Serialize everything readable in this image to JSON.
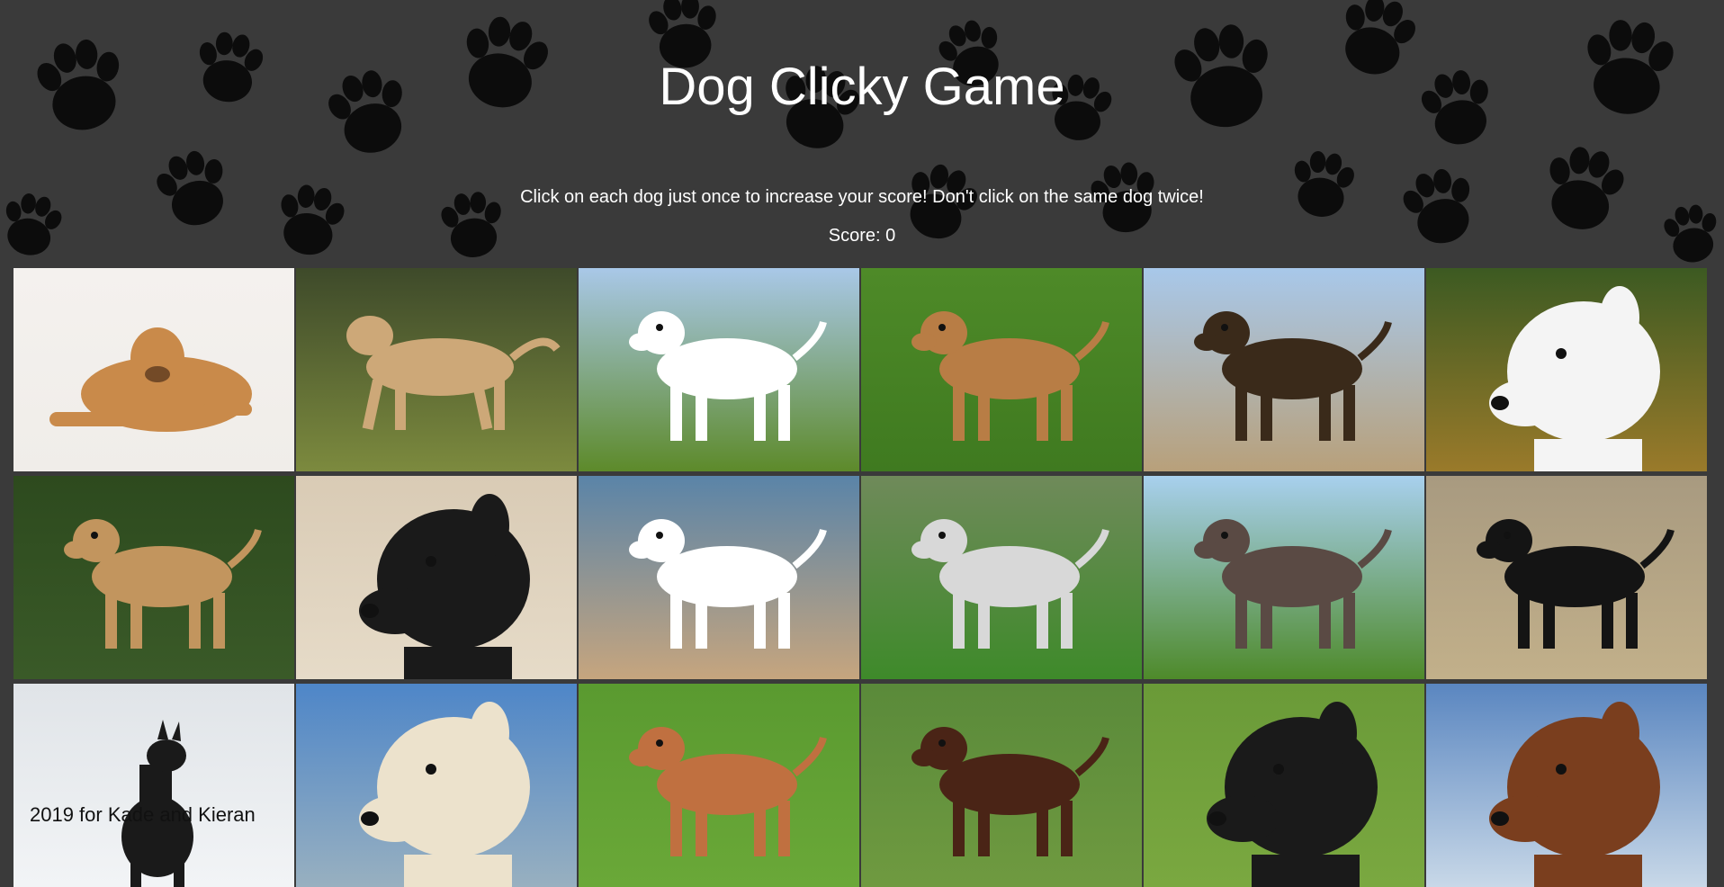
{
  "header": {
    "title": "Dog Clicky Game",
    "instructions": "Click on each dog just once to increase your score! Don't click on the same dog twice!",
    "score_label": "Score: 0"
  },
  "footer": {
    "text": "2019 for Kade and Kieran"
  },
  "colors": {
    "background": "#3a3a3a",
    "paw_print": "#0c0c0c",
    "text": "#ffffff"
  },
  "dogs": [
    {
      "breed": "golden-retriever",
      "bg_top": "#f4f1ee",
      "bg_bottom": "#f0ede9",
      "dog": "#c98a4a",
      "pose": "lying"
    },
    {
      "breed": "irish-wolfhound",
      "bg_top": "#3e4a2a",
      "bg_bottom": "#7c8a3e",
      "dog": "#cda878",
      "pose": "walking"
    },
    {
      "breed": "beagle",
      "bg_top": "#a9c8e8",
      "bg_bottom": "#5d8a2a",
      "dog": "#ffffff",
      "pose": "standing"
    },
    {
      "breed": "vizsla",
      "bg_top": "#4e8a28",
      "bg_bottom": "#3f7a20",
      "dog": "#b87d45",
      "pose": "standing"
    },
    {
      "breed": "german-shepherd",
      "bg_top": "#a8c8ea",
      "bg_bottom": "#b8a07a",
      "dog": "#3a2a1a",
      "pose": "standing"
    },
    {
      "breed": "bull-terrier",
      "bg_top": "#3c5a22",
      "bg_bottom": "#9a7a2a",
      "dog": "#f4f4f4",
      "pose": "head"
    },
    {
      "breed": "shar-pei",
      "bg_top": "#2d4a1e",
      "bg_bottom": "#3a5a28",
      "dog": "#c2955e",
      "pose": "standing"
    },
    {
      "breed": "tibetan-mastiff",
      "bg_top": "#d9cbb5",
      "bg_bottom": "#e6dbc8",
      "dog": "#1a1a1a",
      "pose": "head"
    },
    {
      "breed": "jack-russell",
      "bg_top": "#5a84a8",
      "bg_bottom": "#c6a57e",
      "dog": "#ffffff",
      "pose": "standing"
    },
    {
      "breed": "bluetick-coonhound",
      "bg_top": "#6f8a5a",
      "bg_bottom": "#3e8a2a",
      "dog": "#d8d8d8",
      "pose": "standing"
    },
    {
      "breed": "german-wirehaired-pointer",
      "bg_top": "#a8d0ee",
      "bg_bottom": "#4e8a2a",
      "dog": "#5a4a44",
      "pose": "standing"
    },
    {
      "breed": "rottweiler",
      "bg_top": "#a89a80",
      "bg_bottom": "#c2b08a",
      "dog": "#141414",
      "pose": "standing"
    },
    {
      "breed": "great-dane-black",
      "bg_top": "#e0e4e8",
      "bg_bottom": "#f2f4f6",
      "dog": "#1a1a1a",
      "pose": "sitting"
    },
    {
      "breed": "labrador-cream",
      "bg_top": "#4e86c8",
      "bg_bottom": "#98b0c0",
      "dog": "#ece2cc",
      "pose": "head"
    },
    {
      "breed": "pharaoh-hound",
      "bg_top": "#5a9a30",
      "bg_bottom": "#6aa838",
      "dog": "#c07040",
      "pose": "standing"
    },
    {
      "breed": "doberman",
      "bg_top": "#5a8a3a",
      "bg_bottom": "#6f9a40",
      "dog": "#4a2416",
      "pose": "standing"
    },
    {
      "breed": "rough-collie",
      "bg_top": "#6a9a38",
      "bg_bottom": "#7aa840",
      "dog": "#1a1a1a",
      "pose": "head"
    },
    {
      "breed": "saint-bernard",
      "bg_top": "#5a86c0",
      "bg_bottom": "#c8d8e8",
      "dog": "#7a3e1e",
      "pose": "head"
    }
  ]
}
